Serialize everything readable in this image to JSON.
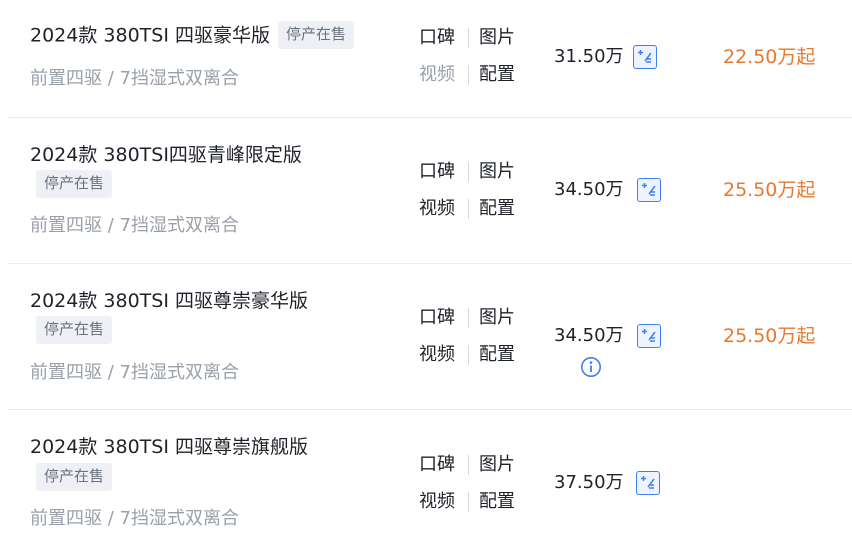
{
  "colors": {
    "accent_orange": "#e8782f",
    "calc_blue": "#3d7ff5",
    "badge_bg": "#eef0f5",
    "muted_text": "#9aa0a9",
    "divider": "#e8eaee"
  },
  "rows": [
    {
      "title": "2024款 380TSI 四驱豪华版",
      "badge": "停产在售",
      "spec": "前置四驱 / 7挡湿式双离合",
      "links": [
        "口碑",
        "图片",
        "视频",
        "配置"
      ],
      "price": "31.50万",
      "guide_price": "22.50万起",
      "icons": [
        "calculator-icon"
      ]
    },
    {
      "title": "2024款 380TSI四驱青峰限定版",
      "badge": "停产在售",
      "spec": "前置四驱 / 7挡湿式双离合",
      "links": [
        "口碑",
        "图片",
        "视频",
        "配置"
      ],
      "price": "34.50万",
      "guide_price": "25.50万起",
      "icons": [
        "calculator-icon"
      ]
    },
    {
      "title": "2024款 380TSI 四驱尊崇豪华版",
      "badge": "停产在售",
      "spec": "前置四驱 / 7挡湿式双离合",
      "links": [
        "口碑",
        "图片",
        "视频",
        "配置"
      ],
      "price": "34.50万",
      "guide_price": "25.50万起",
      "icons": [
        "calculator-icon",
        "info-icon"
      ]
    },
    {
      "title": "2024款 380TSI 四驱尊崇旗舰版",
      "badge": "停产在售",
      "spec": "前置四驱 / 7挡湿式双离合",
      "links": [
        "口碑",
        "图片",
        "视频",
        "配置"
      ],
      "price": "37.50万",
      "guide_price": "",
      "icons": [
        "calculator-icon"
      ]
    }
  ]
}
